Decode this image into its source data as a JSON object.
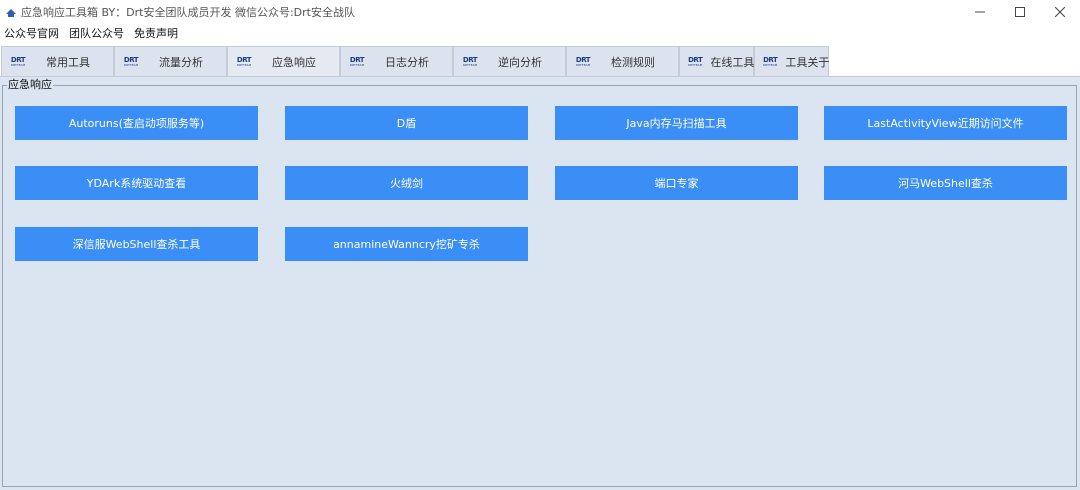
{
  "window": {
    "title": "应急响应工具箱   BY：Drt安全团队成员开发    微信公众号:Drt安全战队",
    "icon": "app-icon",
    "controls": [
      "minimize-icon",
      "maximize-icon",
      "close-icon"
    ]
  },
  "menu": {
    "items": [
      "公众号官网",
      "团队公众号",
      "免责声明"
    ]
  },
  "tabs": {
    "logo_text": "DRT",
    "logo_sub": "DRTTEAM",
    "active": "应急响应",
    "items": [
      "常用工具",
      "流量分析",
      "应急响应",
      "日志分析",
      "逆向分析",
      "检测规则",
      "在线工具",
      "工具关于"
    ]
  },
  "group": {
    "title": "应急响应"
  },
  "buttons": {
    "items": [
      "Autoruns(查启动项服务等)",
      "D盾",
      "Java内存马扫描工具",
      "LastActivityView近期访问文件",
      "YDArk系统驱动查看",
      "火绒剑",
      "端口专家",
      "河马WebShell查杀",
      "深信服WebShell查杀工具",
      "annamineWanncry挖矿专杀"
    ]
  },
  "colors": {
    "button_bg": "#3a8ef6",
    "content_bg": "#dbe4f1",
    "tab_bg": "#dde3ee"
  }
}
